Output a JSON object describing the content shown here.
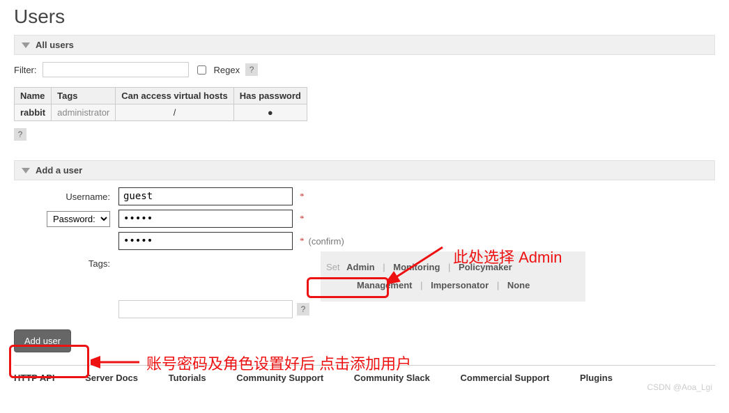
{
  "page_title": "Users",
  "sections": {
    "all_users": "All users",
    "add_user": "Add a user"
  },
  "filter": {
    "label": "Filter:",
    "value": "",
    "regex_label": "Regex",
    "regex_checked": false,
    "help": "?"
  },
  "table": {
    "headers": [
      "Name",
      "Tags",
      "Can access virtual hosts",
      "Has password"
    ],
    "rows": [
      {
        "name": "rabbit",
        "tags": "administrator",
        "vhosts": "/",
        "has_password": "●"
      }
    ]
  },
  "help_icon": "?",
  "form": {
    "username_label": "Username:",
    "username_value": "guest",
    "password_select": "Password:",
    "password_value": "•••••",
    "password_confirm_value": "•••••",
    "confirm_text": "(confirm)",
    "required": "*",
    "tags_label": "Tags:",
    "tags_value": "",
    "tag_set": "Set",
    "tag_options": [
      "Admin",
      "Monitoring",
      "Policymaker",
      "Management",
      "Impersonator",
      "None"
    ],
    "submit": "Add user"
  },
  "annotations": {
    "pick_admin": "此处选择 Admin",
    "after_set": "账号密码及角色设置好后 点击添加用户"
  },
  "footer": [
    "HTTP API",
    "Server Docs",
    "Tutorials",
    "Community Support",
    "Community Slack",
    "Commercial Support",
    "Plugins"
  ],
  "watermark": "CSDN @Aoa_Lgi"
}
